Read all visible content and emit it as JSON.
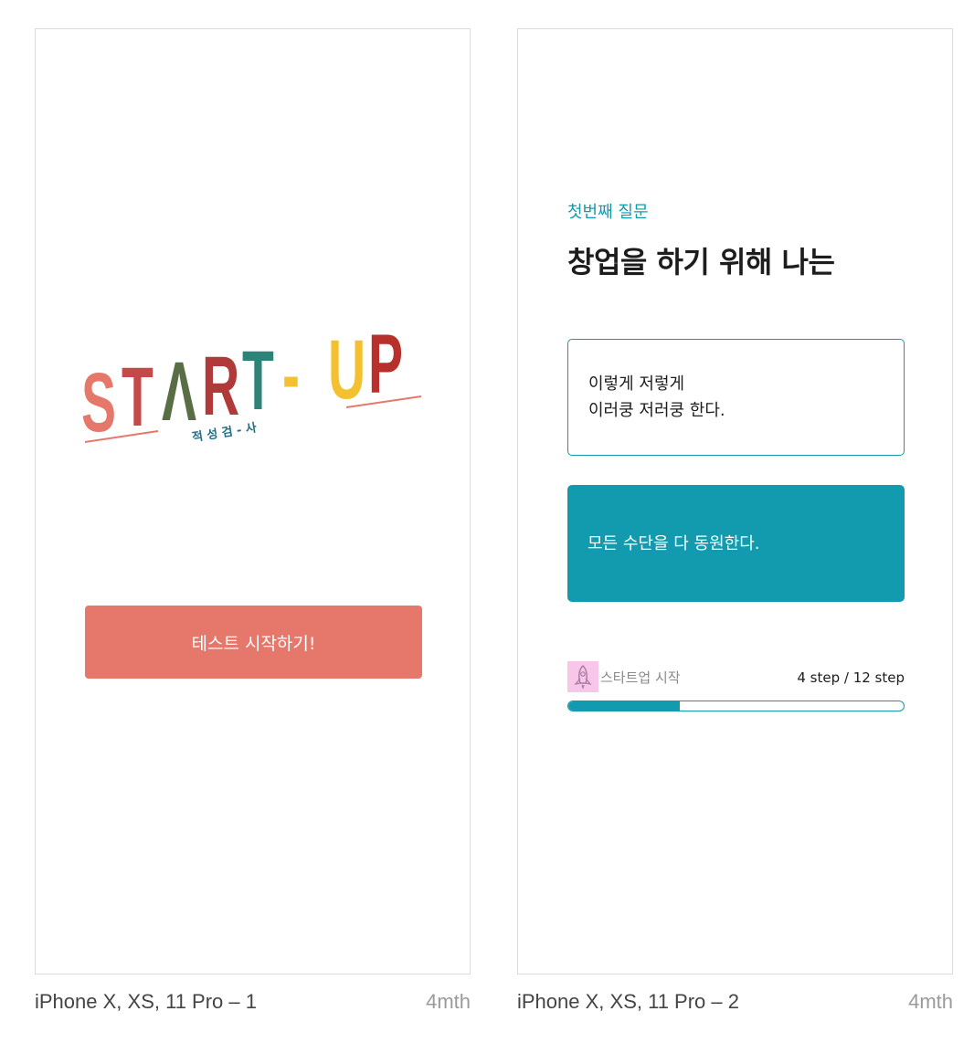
{
  "colors": {
    "accent": "#129bae",
    "start_button": "#e5786b",
    "logo_underline": "#e5786b",
    "logo_letters": [
      "#e5786b",
      "#c44a4a",
      "#5a6e45",
      "#b03a3a",
      "#2e8378",
      "#a8b878",
      "#f3c02f",
      "#b8302c",
      "#c94848"
    ],
    "rocket_bg": "#f7c6e8"
  },
  "frames": [
    {
      "name": "iPhone X, XS, 11 Pro – 1",
      "owner": "4mth"
    },
    {
      "name": "iPhone X, XS, 11 Pro – 2",
      "owner": "4mth"
    }
  ],
  "screen1": {
    "logo": {
      "letters": [
        "S",
        "T",
        "Λ",
        "R",
        "T",
        "-",
        "U",
        "P"
      ],
      "subtitle": "적 성 검 - 사"
    },
    "start_button_label": "테스트 시작하기!"
  },
  "screen2": {
    "question_number": "첫번째 질문",
    "question_title": "창업을 하기 위해 나는",
    "answers": [
      {
        "line1": "이렇게 저렇게",
        "line2": "이러쿵 저러쿵 한다."
      },
      {
        "line1": "모든 수단을 다 동원한다."
      }
    ],
    "progress": {
      "icon": "rocket-icon",
      "label": "스타트업 시작",
      "step_text": "4 step / 12 step",
      "current": 4,
      "total": 12
    }
  }
}
